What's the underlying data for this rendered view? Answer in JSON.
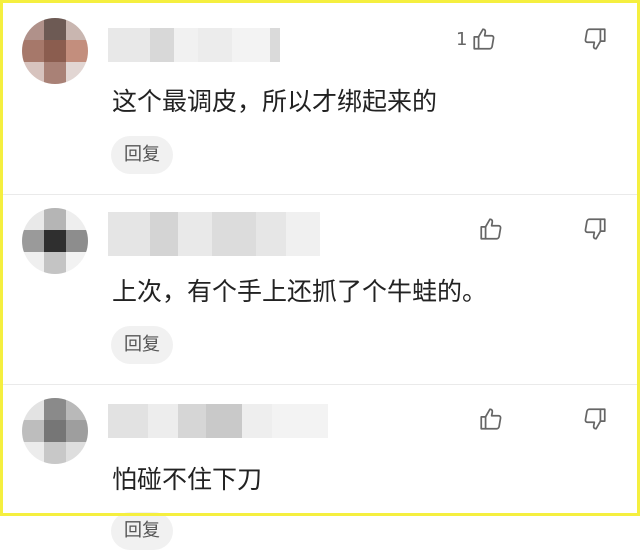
{
  "comments": [
    {
      "like_count": "1",
      "text": "这个最调皮，所以才绑起来的",
      "reply_label": "回复",
      "like_icon": "thumbs-up-icon",
      "dislike_icon": "thumbs-down-icon"
    },
    {
      "like_count": "",
      "text": "上次，有个手上还抓了个牛蛙的。",
      "reply_label": "回复",
      "like_icon": "thumbs-up-icon",
      "dislike_icon": "thumbs-down-icon"
    },
    {
      "like_count": "",
      "text": "怕碰不住下刀",
      "reply_label": "回复",
      "like_icon": "thumbs-up-icon",
      "dislike_icon": "thumbs-down-icon"
    }
  ],
  "colors": {
    "frame": "#f5ef3f",
    "text": "#222222",
    "icon": "#666666",
    "reply_bg": "#f1f1f1"
  }
}
